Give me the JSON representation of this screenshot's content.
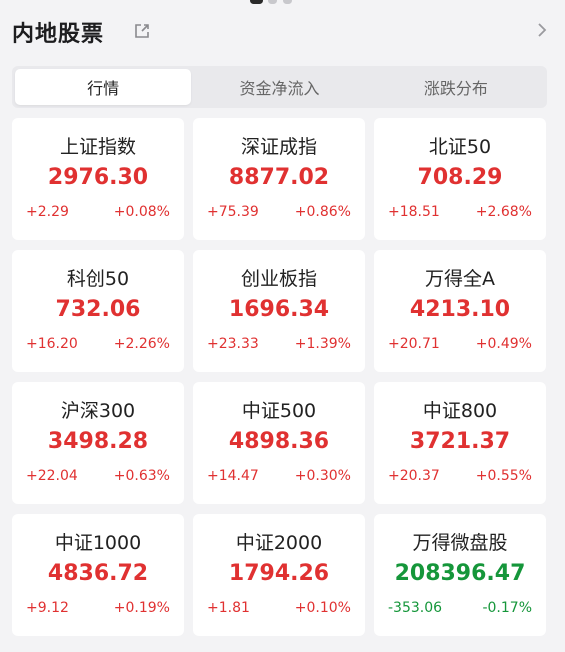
{
  "header": {
    "title": "内地股票"
  },
  "tabs": [
    {
      "label": "行情",
      "active": true
    },
    {
      "label": "资金净流入",
      "active": false
    },
    {
      "label": "涨跌分布",
      "active": false
    }
  ],
  "indices": [
    {
      "name": "上证指数",
      "value": "2976.30",
      "change": "+2.29",
      "pct": "+0.08%",
      "trend": "up"
    },
    {
      "name": "深证成指",
      "value": "8877.02",
      "change": "+75.39",
      "pct": "+0.86%",
      "trend": "up"
    },
    {
      "name": "北证50",
      "value": "708.29",
      "change": "+18.51",
      "pct": "+2.68%",
      "trend": "up"
    },
    {
      "name": "科创50",
      "value": "732.06",
      "change": "+16.20",
      "pct": "+2.26%",
      "trend": "up"
    },
    {
      "name": "创业板指",
      "value": "1696.34",
      "change": "+23.33",
      "pct": "+1.39%",
      "trend": "up"
    },
    {
      "name": "万得全A",
      "value": "4213.10",
      "change": "+20.71",
      "pct": "+0.49%",
      "trend": "up"
    },
    {
      "name": "沪深300",
      "value": "3498.28",
      "change": "+22.04",
      "pct": "+0.63%",
      "trend": "up"
    },
    {
      "name": "中证500",
      "value": "4898.36",
      "change": "+14.47",
      "pct": "+0.30%",
      "trend": "up"
    },
    {
      "name": "中证800",
      "value": "3721.37",
      "change": "+20.37",
      "pct": "+0.55%",
      "trend": "up"
    },
    {
      "name": "中证1000",
      "value": "4836.72",
      "change": "+9.12",
      "pct": "+0.19%",
      "trend": "up"
    },
    {
      "name": "中证2000",
      "value": "1794.26",
      "change": "+1.81",
      "pct": "+0.10%",
      "trend": "up"
    },
    {
      "name": "万得微盘股",
      "value": "208396.47",
      "change": "-353.06",
      "pct": "-0.17%",
      "trend": "down"
    }
  ],
  "colors": {
    "up": "#e03131",
    "down": "#15963a",
    "background": "#f3f3f5"
  },
  "icons": [
    "share-icon",
    "chevron-right-icon"
  ]
}
